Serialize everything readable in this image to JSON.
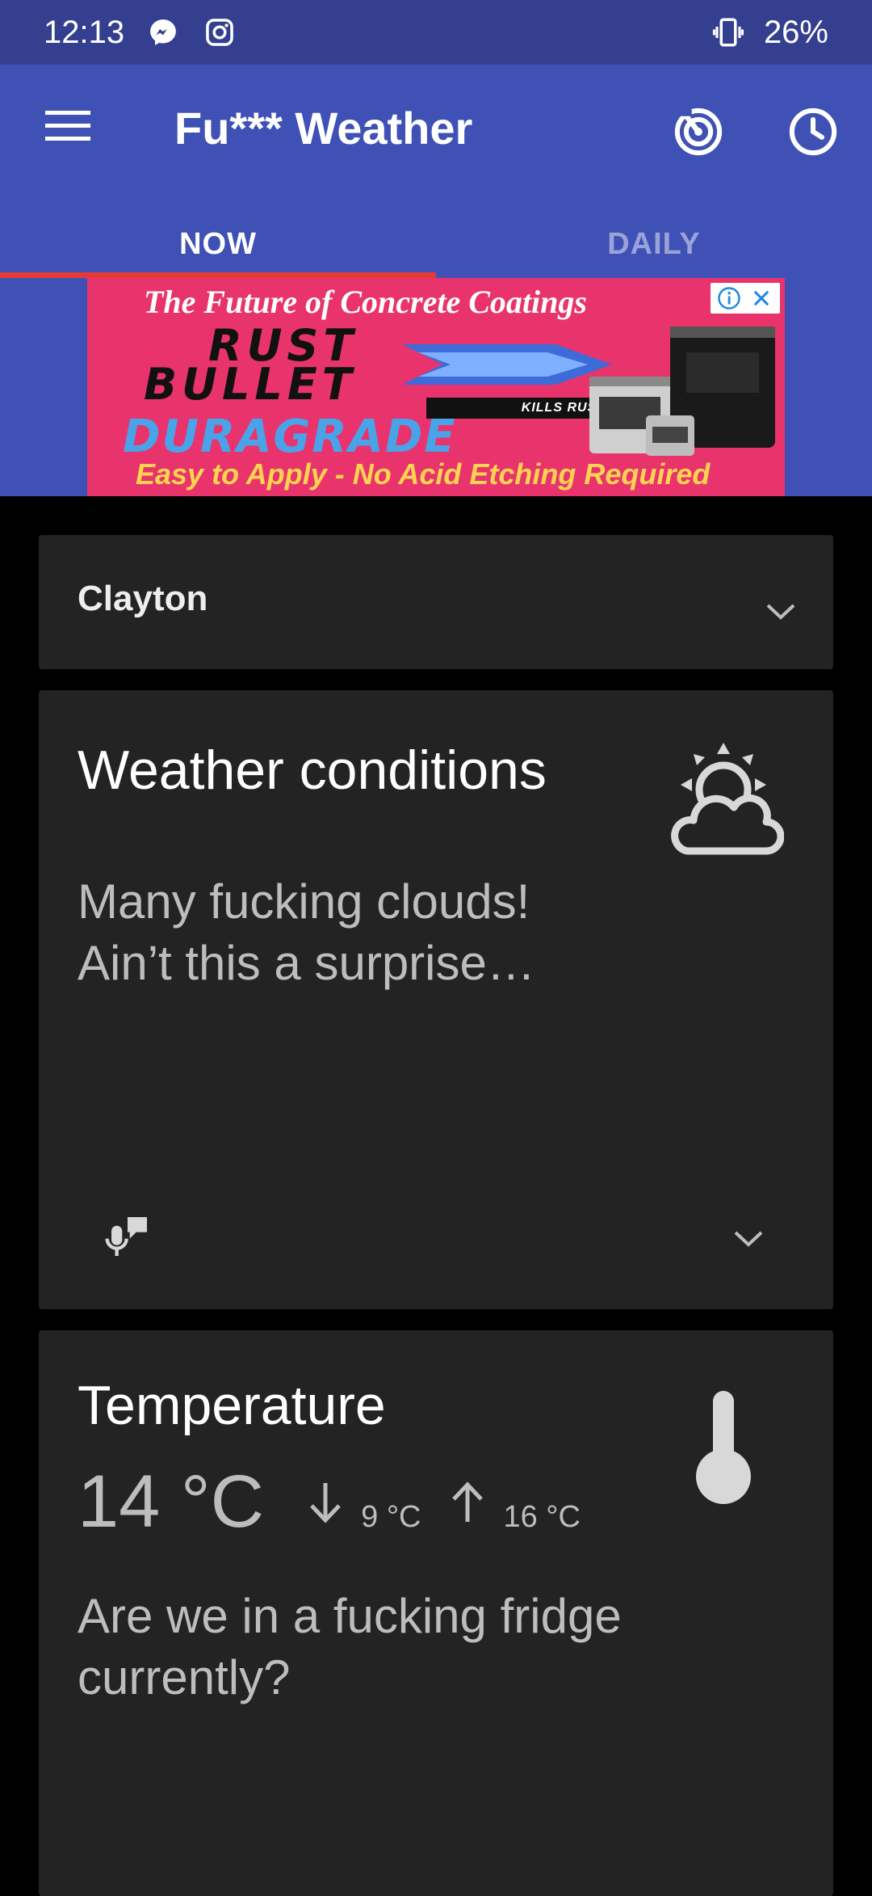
{
  "status_bar": {
    "time": "12:13",
    "battery": "26%",
    "icons": [
      "messenger-icon",
      "instagram-icon",
      "vibrate-icon"
    ]
  },
  "app_bar": {
    "title": "Fu*** Weather",
    "actions": [
      "radar-icon",
      "clock-icon"
    ]
  },
  "tabs": [
    {
      "label": "NOW",
      "active": true
    },
    {
      "label": "DAILY",
      "active": false
    }
  ],
  "ad": {
    "headline": "The Future of Concrete Coatings",
    "brand_line1": "RUST",
    "brand_line2": "BULLET",
    "kills_rust": "KILLS RUST",
    "product": "DURAGRADE",
    "tagline": "Easy to Apply - No Acid Etching Required"
  },
  "location": {
    "name": "Clayton"
  },
  "weather_card": {
    "title": "Weather conditions",
    "line1": "Many fucking clouds!",
    "line2": "Ain’t this a surprise…",
    "icon": "partly-cloudy-icon"
  },
  "temperature_card": {
    "title": "Temperature",
    "current": "14 °C",
    "low": "9 °C",
    "high": "16 °C",
    "line1": "Are we in a fucking fridge",
    "line2": "currently?",
    "icon": "thermometer-icon"
  },
  "colors": {
    "status_bar": "#353f8f",
    "primary": "#3f51b5",
    "tab_indicator": "#e53935",
    "card_bg": "#232323",
    "background": "#000000"
  }
}
